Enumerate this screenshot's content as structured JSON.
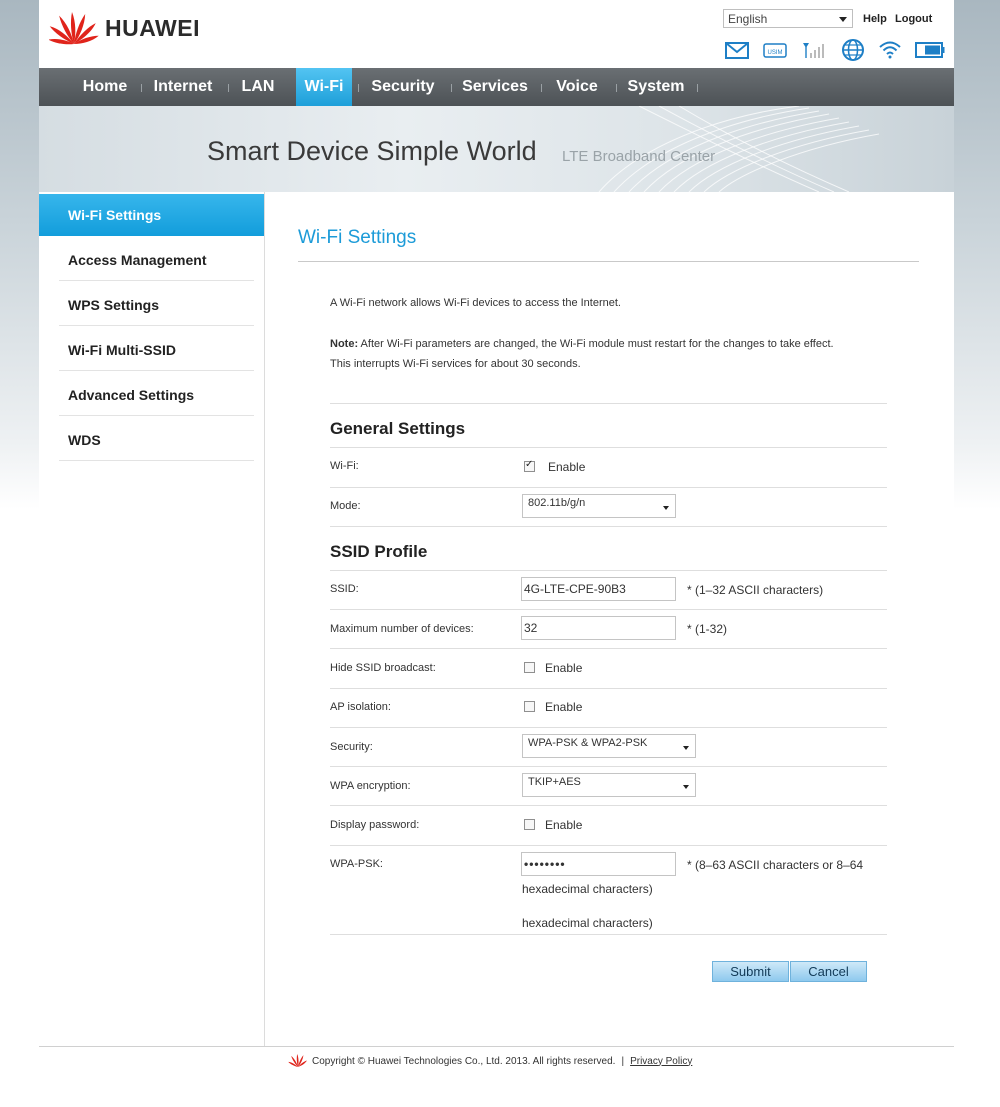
{
  "header": {
    "brand": "HUAWEI",
    "language": "English",
    "help_label": "Help",
    "logout_label": "Logout",
    "status_icons": [
      "mail-icon",
      "usim-icon",
      "signal-icon",
      "globe-icon",
      "wifi-icon",
      "battery-icon"
    ],
    "usim_text": "USIM"
  },
  "nav": {
    "items": [
      "Home",
      "Internet",
      "LAN",
      "Wi-Fi",
      "Security",
      "Services",
      "Voice",
      "System"
    ],
    "active": "Wi-Fi"
  },
  "banner": {
    "main": "Smart Device   Simple World",
    "sub": "LTE  Broadband  Center"
  },
  "sidebar": {
    "items": [
      "Wi-Fi Settings",
      "Access Management",
      "WPS Settings",
      "Wi-Fi Multi-SSID",
      "Advanced Settings",
      "WDS"
    ],
    "active": "Wi-Fi Settings"
  },
  "content": {
    "title": "Wi-Fi Settings",
    "intro": "A Wi-Fi network allows Wi-Fi devices to access the Internet.",
    "note_label": "Note:",
    "note_text": " After Wi-Fi parameters are changed, the Wi-Fi module must restart for the changes to take effect.",
    "note_line2": "This interrupts Wi-Fi services for about 30 seconds.",
    "general": {
      "title": "General Settings",
      "wifi_label": "Wi-Fi:",
      "wifi_enable": "Enable",
      "wifi_checked": true,
      "mode_label": "Mode:",
      "mode_value": "802.11b/g/n"
    },
    "ssid": {
      "title": "SSID Profile",
      "ssid_label": "SSID:",
      "ssid_value": "4G-LTE-CPE-90B3",
      "ssid_hint": "*  (1–32 ASCII characters)",
      "max_label": "Maximum number of devices:",
      "max_value": "32",
      "max_hint": "*  (1-32)",
      "hide_label": "Hide SSID broadcast:",
      "hide_enable": "Enable",
      "ap_label": "AP isolation:",
      "ap_enable": "Enable",
      "security_label": "Security:",
      "security_value": "WPA-PSK & WPA2-PSK",
      "wpa_enc_label": "WPA encryption:",
      "wpa_enc_value": "TKIP+AES",
      "display_pw_label": "Display password:",
      "display_pw_enable": "Enable",
      "psk_label": "WPA-PSK:",
      "psk_value": "••••••••",
      "psk_hint": "*  (8–63 ASCII characters or 8–64",
      "psk_hint2": "hexadecimal characters)"
    },
    "submit_label": "Submit",
    "cancel_label": "Cancel"
  },
  "footer": {
    "copyright": "Copyright © Huawei Technologies Co., Ltd. 2013. All rights reserved.",
    "separator": "|",
    "privacy": "Privacy Policy"
  },
  "colors": {
    "accent": "#1c9bd8",
    "nav_bg": "#585d61",
    "brand_red": "#e0241b"
  }
}
